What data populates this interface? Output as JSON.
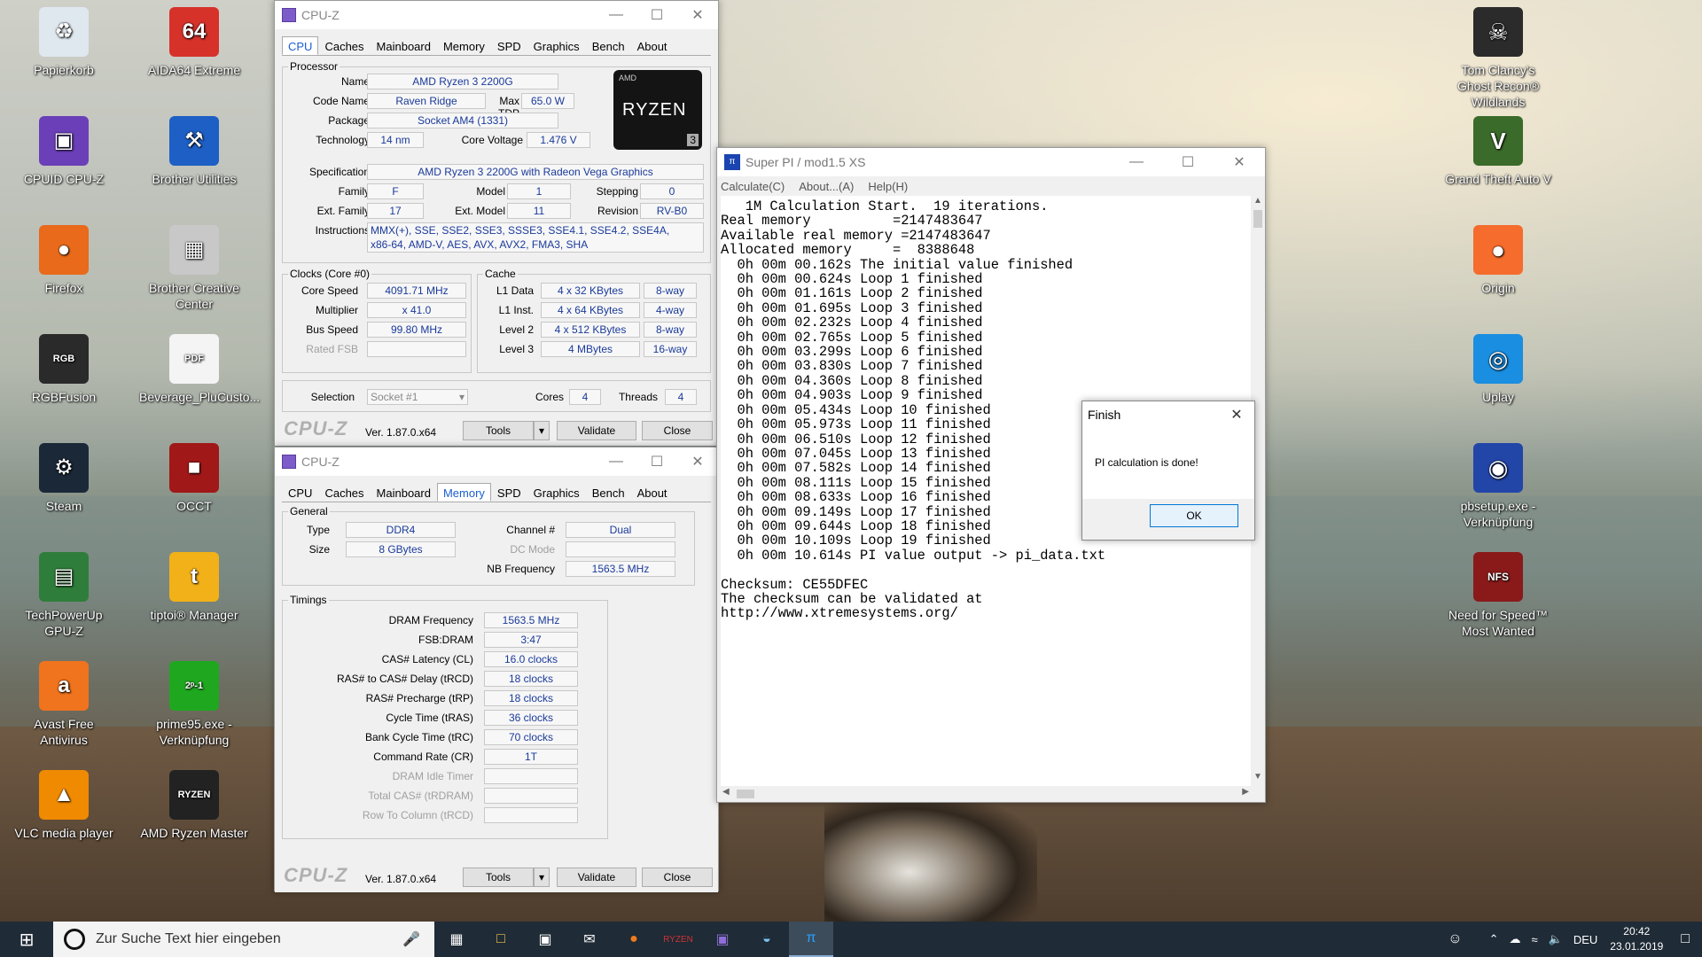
{
  "desktop": {
    "left_icons": [
      {
        "label": "Papierkorb",
        "icon": "recycle-bin-icon",
        "color": "#dfe7ef",
        "glyph": "♻"
      },
      {
        "label": "AIDA64 Extreme",
        "icon": "aida64-icon",
        "color": "#d6322a",
        "glyph": "64"
      },
      {
        "label": "CPUID CPU-Z",
        "icon": "cpuz-icon",
        "color": "#6b3fb8",
        "glyph": "▣"
      },
      {
        "label": "Brother Utilities",
        "icon": "brother-utilities-icon",
        "color": "#1d5fc4",
        "glyph": "⚒"
      },
      {
        "label": "Firefox",
        "icon": "firefox-icon",
        "color": "#e86a1a",
        "glyph": "●"
      },
      {
        "label": "Brother Creative Center",
        "icon": "brother-creative-icon",
        "color": "#c8c8c8",
        "glyph": "▦"
      },
      {
        "label": "RGBFusion",
        "icon": "rgbfusion-icon",
        "color": "#2a2a2a",
        "glyph": "RGB"
      },
      {
        "label": "Beverage_PluCusto...",
        "icon": "pdf-icon",
        "color": "#f4f4f4",
        "glyph": "PDF"
      },
      {
        "label": "Steam",
        "icon": "steam-icon",
        "color": "#1b2838",
        "glyph": "⚙"
      },
      {
        "label": "OCCT",
        "icon": "occt-icon",
        "color": "#a01818",
        "glyph": "■"
      },
      {
        "label": "TechPowerUp GPU-Z",
        "icon": "gpuz-icon",
        "color": "#2f7d3a",
        "glyph": "▤"
      },
      {
        "label": "tiptoi® Manager",
        "icon": "tiptoi-icon",
        "color": "#f2b118",
        "glyph": "t"
      },
      {
        "label": "Avast Free Antivirus",
        "icon": "avast-icon",
        "color": "#f0731e",
        "glyph": "a"
      },
      {
        "label": "prime95.exe - Verknüpfung",
        "icon": "prime95-icon",
        "color": "#1fa81f",
        "glyph": "2ᵖ-1"
      },
      {
        "label": "VLC media player",
        "icon": "vlc-icon",
        "color": "#f08a00",
        "glyph": "▲"
      },
      {
        "label": "AMD Ryzen Master",
        "icon": "ryzen-master-icon",
        "color": "#222",
        "glyph": "RYZEN"
      }
    ],
    "right_icons": [
      {
        "label": "Tom Clancy's Ghost Recon® Wildlands",
        "icon": "ghost-recon-icon",
        "color": "#2b2b2b",
        "glyph": "☠"
      },
      {
        "label": "Grand Theft Auto V",
        "icon": "gta5-icon",
        "color": "#3a6b2a",
        "glyph": "V"
      },
      {
        "label": "Origin",
        "icon": "origin-icon",
        "color": "#f56c2d",
        "glyph": "●"
      },
      {
        "label": "Uplay",
        "icon": "uplay-icon",
        "color": "#1a8ee0",
        "glyph": "◎"
      },
      {
        "label": "pbsetup.exe - Verknüpfung",
        "icon": "pbsetup-icon",
        "color": "#2245a8",
        "glyph": "◉"
      },
      {
        "label": "Need for Speed™ Most Wanted",
        "icon": "nfs-icon",
        "color": "#8a1a1a",
        "glyph": "NFS"
      }
    ]
  },
  "cpuz_cpu": {
    "title": "CPU-Z",
    "tabs": [
      "CPU",
      "Caches",
      "Mainboard",
      "Memory",
      "SPD",
      "Graphics",
      "Bench",
      "About"
    ],
    "active_tab": "CPU",
    "processor_group": "Processor",
    "name_label": "Name",
    "name": "AMD Ryzen 3 2200G",
    "code_label": "Code Name",
    "code": "Raven Ridge",
    "tdp_label": "Max TDP",
    "tdp": "65.0 W",
    "package_label": "Package",
    "package": "Socket AM4 (1331)",
    "tech_label": "Technology",
    "tech": "14 nm",
    "voltage_label": "Core Voltage",
    "voltage": "1.476 V",
    "spec_label": "Specification",
    "spec": "AMD Ryzen 3 2200G with Radeon Vega Graphics",
    "family_label": "Family",
    "family": "F",
    "model_label": "Model",
    "model": "1",
    "stepping_label": "Stepping",
    "stepping": "0",
    "extfam_label": "Ext. Family",
    "extfam": "17",
    "extmodel_label": "Ext. Model",
    "extmodel": "11",
    "revision_label": "Revision",
    "revision": "RV-B0",
    "instr_label": "Instructions",
    "instr": "MMX(+), SSE, SSE2, SSE3, SSSE3, SSE4.1, SSE4.2, SSE4A,\nx86-64, AMD-V, AES, AVX, AVX2, FMA3, SHA",
    "logo_brand": "AMD",
    "logo_text": "RYZEN",
    "logo_num": "3",
    "clocks_group": "Clocks (Core #0)",
    "speed_label": "Core Speed",
    "speed": "4091.71 MHz",
    "mult_label": "Multiplier",
    "mult": "x 41.0",
    "bus_label": "Bus Speed",
    "bus": "99.80 MHz",
    "fsb_label": "Rated FSB",
    "fsb": "",
    "cache_group": "Cache",
    "l1d_label": "L1 Data",
    "l1d": "4 x 32 KBytes",
    "l1d_w": "8-way",
    "l1i_label": "L1 Inst.",
    "l1i": "4 x 64 KBytes",
    "l1i_w": "4-way",
    "l2_label": "Level 2",
    "l2": "4 x 512 KBytes",
    "l2_w": "8-way",
    "l3_label": "Level 3",
    "l3": "4 MBytes",
    "l3_w": "16-way",
    "selection_label": "Selection",
    "selection": "Socket #1",
    "cores_label": "Cores",
    "cores": "4",
    "threads_label": "Threads",
    "threads": "4",
    "brand": "CPU-Z",
    "version": "Ver. 1.87.0.x64",
    "tools": "Tools",
    "validate": "Validate",
    "close": "Close"
  },
  "cpuz_mem": {
    "title": "CPU-Z",
    "tabs": [
      "CPU",
      "Caches",
      "Mainboard",
      "Memory",
      "SPD",
      "Graphics",
      "Bench",
      "About"
    ],
    "active_tab": "Memory",
    "general_group": "General",
    "type_label": "Type",
    "type": "DDR4",
    "size_label": "Size",
    "size": "8 GBytes",
    "channel_label": "Channel #",
    "channel": "Dual",
    "dc_label": "DC Mode",
    "dc": "",
    "nb_label": "NB Frequency",
    "nb": "1563.5 MHz",
    "timings_group": "Timings",
    "timings": [
      {
        "label": "DRAM Frequency",
        "value": "1563.5 MHz",
        "disabled": false
      },
      {
        "label": "FSB:DRAM",
        "value": "3:47",
        "disabled": false
      },
      {
        "label": "CAS# Latency (CL)",
        "value": "16.0 clocks",
        "disabled": false
      },
      {
        "label": "RAS# to CAS# Delay (tRCD)",
        "value": "18 clocks",
        "disabled": false
      },
      {
        "label": "RAS# Precharge (tRP)",
        "value": "18 clocks",
        "disabled": false
      },
      {
        "label": "Cycle Time (tRAS)",
        "value": "36 clocks",
        "disabled": false
      },
      {
        "label": "Bank Cycle Time (tRC)",
        "value": "70 clocks",
        "disabled": false
      },
      {
        "label": "Command Rate (CR)",
        "value": "1T",
        "disabled": false
      },
      {
        "label": "DRAM Idle Timer",
        "value": "",
        "disabled": true
      },
      {
        "label": "Total CAS# (tRDRAM)",
        "value": "",
        "disabled": true
      },
      {
        "label": "Row To Column (tRCD)",
        "value": "",
        "disabled": true
      }
    ],
    "brand": "CPU-Z",
    "version": "Ver. 1.87.0.x64",
    "tools": "Tools",
    "validate": "Validate",
    "close": "Close"
  },
  "superpi": {
    "title": "Super PI / mod1.5 XS",
    "menus": [
      "Calculate(C)",
      "About...(A)",
      "Help(H)"
    ],
    "output": "   1M Calculation Start.  19 iterations.\nReal memory          =2147483647\nAvailable real memory =2147483647\nAllocated memory     =  8388648\n  0h 00m 00.162s The initial value finished\n  0h 00m 00.624s Loop 1 finished\n  0h 00m 01.161s Loop 2 finished\n  0h 00m 01.695s Loop 3 finished\n  0h 00m 02.232s Loop 4 finished\n  0h 00m 02.765s Loop 5 finished\n  0h 00m 03.299s Loop 6 finished\n  0h 00m 03.830s Loop 7 finished\n  0h 00m 04.360s Loop 8 finished\n  0h 00m 04.903s Loop 9 finished\n  0h 00m 05.434s Loop 10 finished\n  0h 00m 05.973s Loop 11 finished\n  0h 00m 06.510s Loop 12 finished\n  0h 00m 07.045s Loop 13 finished\n  0h 00m 07.582s Loop 14 finished\n  0h 00m 08.111s Loop 15 finished\n  0h 00m 08.633s Loop 16 finished\n  0h 00m 09.149s Loop 17 finished\n  0h 00m 09.644s Loop 18 finished\n  0h 00m 10.109s Loop 19 finished\n  0h 00m 10.614s PI value output -> pi_data.txt\n\nChecksum: CE55DFEC\nThe checksum can be validated at\nhttp://www.xtremesystems.org/"
  },
  "finish_dialog": {
    "title": "Finish",
    "message": "PI calculation is done!",
    "ok": "OK"
  },
  "taskbar": {
    "search_placeholder": "Zur Suche Text hier eingeben",
    "language": "DEU",
    "time": "20:42",
    "date": "23.01.2019"
  }
}
